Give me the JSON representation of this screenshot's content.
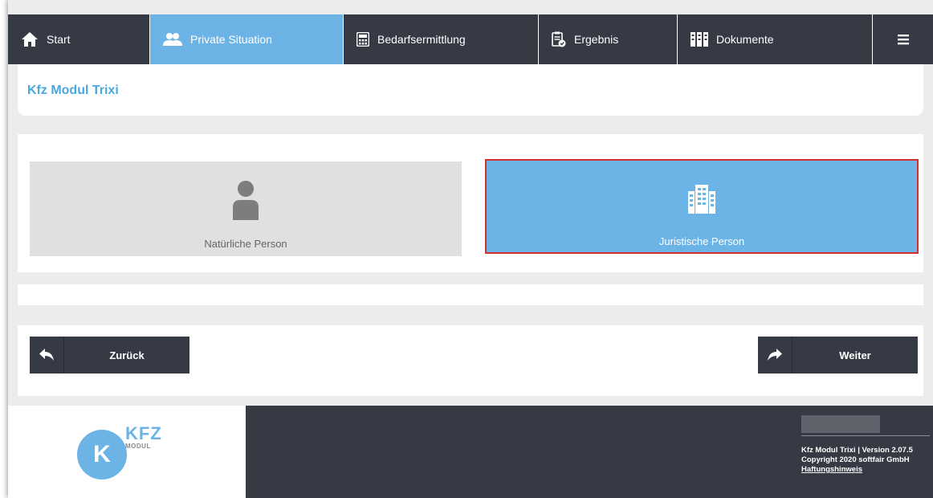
{
  "nav": {
    "items": [
      {
        "label": "Start",
        "icon": "home-icon"
      },
      {
        "label": "Private Situation",
        "icon": "people-icon",
        "active": true
      },
      {
        "label": "Bedarfsermittlung",
        "icon": "calculator-icon"
      },
      {
        "label": "Ergebnis",
        "icon": "clipboard-check-icon"
      },
      {
        "label": "Dokumente",
        "icon": "binders-icon"
      }
    ],
    "menu_icon": "hamburger-menu-icon"
  },
  "page": {
    "title": "Kfz Modul Trixi"
  },
  "options": {
    "natural": {
      "label": "Natürliche Person",
      "icon": "person-icon"
    },
    "juristic": {
      "label": "Juristische Person",
      "icon": "building-icon",
      "selected": true
    }
  },
  "buttons": {
    "back": {
      "label": "Zurück",
      "icon": "reply-arrow-icon"
    },
    "next": {
      "label": "Weiter",
      "icon": "forward-arrow-icon"
    }
  },
  "footer": {
    "logo": {
      "letter": "K",
      "brand": "KFZ",
      "sub": "MODUL"
    },
    "version": "Kfz Modul Trixi | Version 2.07.5",
    "copyright": "Copyright 2020 softfair GmbH",
    "disclaimer_link": "Haftungshinweis"
  },
  "colors": {
    "nav_dark": "#363a45",
    "accent_blue": "#6db4e6",
    "title_blue": "#4aa7e0",
    "selection_border": "#d22f2f",
    "option_grey": "#e0e0e0"
  }
}
